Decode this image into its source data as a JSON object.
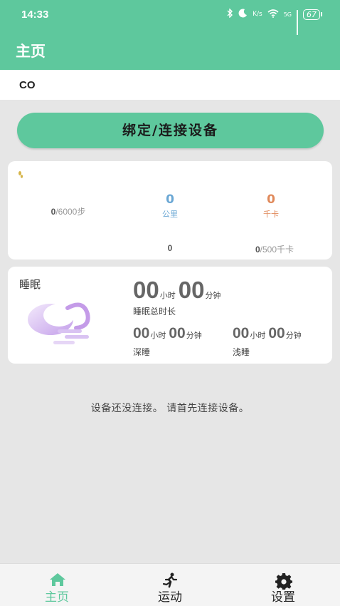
{
  "status_bar": {
    "time": "14:33",
    "battery": "67",
    "net_5g": "5G",
    "speed": "K/s"
  },
  "header": {
    "title": "主页"
  },
  "device": {
    "name": "CO"
  },
  "bind_button": {
    "label": "绑定/连接设备"
  },
  "stats": {
    "steps_current": "0",
    "steps_goal": "/6000步",
    "distance_value": "0",
    "distance_label": "公里",
    "calories_value": "0",
    "calories_label": "千卡",
    "distance_bottom": "0",
    "calories_current": "0",
    "calories_goal": "/500千卡"
  },
  "sleep": {
    "title": "睡眠",
    "total_hours": "00",
    "hour_unit": "小时",
    "total_minutes": "00",
    "minute_unit": "分钟",
    "total_label": "睡眠总时长",
    "deep_hours": "00",
    "deep_minutes": "00",
    "deep_label": "深睡",
    "light_hours": "00",
    "light_minutes": "00",
    "light_label": "浅睡"
  },
  "notice": "设备还没连接。 请首先连接设备。",
  "nav": {
    "home": "主页",
    "sport": "运动",
    "settings": "设置"
  },
  "colors": {
    "accent": "#5ec89d",
    "distance": "#6aa7d4",
    "calories": "#e0895a"
  }
}
